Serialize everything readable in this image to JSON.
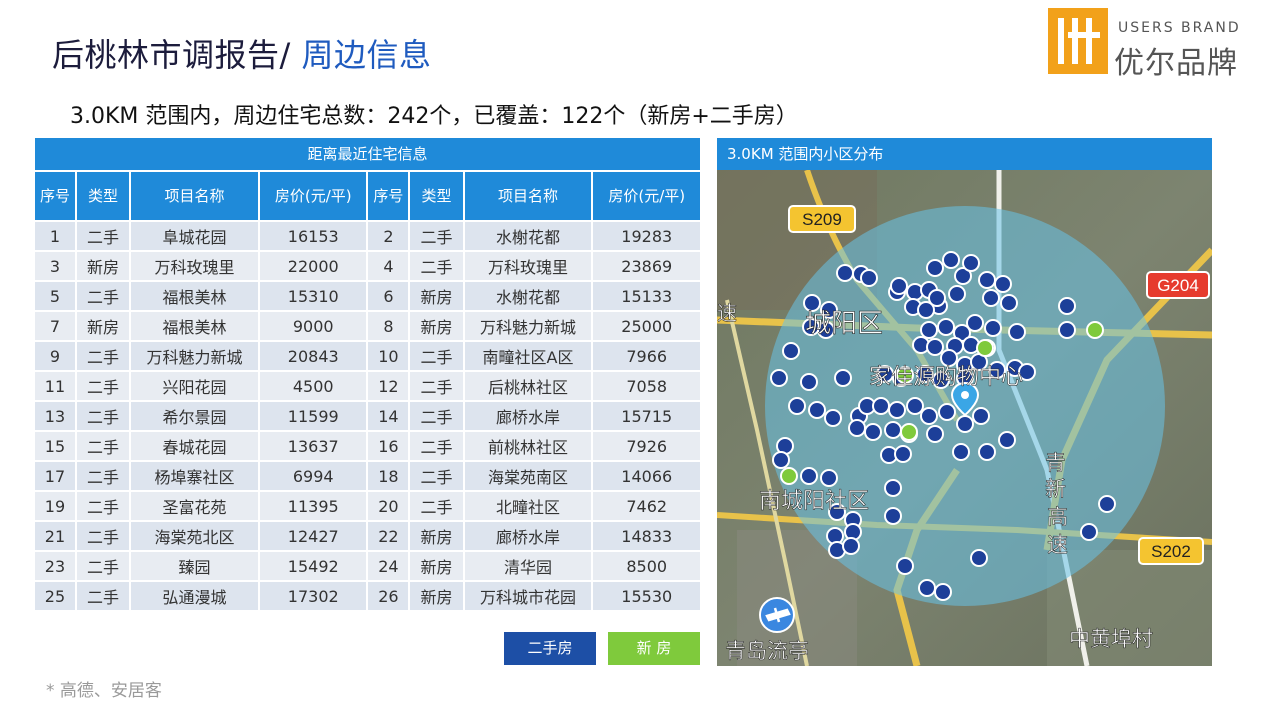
{
  "header": {
    "title_main": "后桃林市调报告/",
    "title_accent": "周边信息"
  },
  "brand": {
    "en": "USERS BRAND",
    "cn": "优尔品牌",
    "mark": "优"
  },
  "subtitle": "3.0KM 范围内，周边住宅总数：242个，已覆盖：122个（新房+二手房）",
  "table": {
    "title": "距离最近住宅信息",
    "columns": [
      "序号",
      "类型",
      "项目名称",
      "房价(元/平)",
      "序号",
      "类型",
      "项目名称",
      "房价(元/平)"
    ],
    "rows": [
      [
        [
          "1",
          "二手",
          "阜城花园",
          "16153"
        ],
        [
          "2",
          "二手",
          "水榭花都",
          "19283"
        ]
      ],
      [
        [
          "3",
          "新房",
          "万科玫瑰里",
          "22000"
        ],
        [
          "4",
          "二手",
          "万科玫瑰里",
          "23869"
        ]
      ],
      [
        [
          "5",
          "二手",
          "福根美林",
          "15310"
        ],
        [
          "6",
          "新房",
          "水榭花都",
          "15133"
        ]
      ],
      [
        [
          "7",
          "新房",
          "福根美林",
          "9000"
        ],
        [
          "8",
          "新房",
          "万科魅力新城",
          "25000"
        ]
      ],
      [
        [
          "9",
          "二手",
          "万科魅力新城",
          "20843"
        ],
        [
          "10",
          "二手",
          "南疃社区A区",
          "7966"
        ]
      ],
      [
        [
          "11",
          "二手",
          "兴阳花园",
          "4500"
        ],
        [
          "12",
          "二手",
          "后桃林社区",
          "7058"
        ]
      ],
      [
        [
          "13",
          "二手",
          "希尔景园",
          "11599"
        ],
        [
          "14",
          "二手",
          "廊桥水岸",
          "15715"
        ]
      ],
      [
        [
          "15",
          "二手",
          "春城花园",
          "13637"
        ],
        [
          "16",
          "二手",
          "前桃林社区",
          "7926"
        ]
      ],
      [
        [
          "17",
          "二手",
          "杨埠寨社区",
          "6994"
        ],
        [
          "18",
          "二手",
          "海棠苑南区",
          "14066"
        ]
      ],
      [
        [
          "19",
          "二手",
          "圣富花苑",
          "11395"
        ],
        [
          "20",
          "二手",
          "北疃社区",
          "7462"
        ]
      ],
      [
        [
          "21",
          "二手",
          "海棠苑北区",
          "12427"
        ],
        [
          "22",
          "新房",
          "廊桥水岸",
          "14833"
        ]
      ],
      [
        [
          "23",
          "二手",
          "臻园",
          "15492"
        ],
        [
          "24",
          "新房",
          "清华园",
          "8500"
        ]
      ],
      [
        [
          "25",
          "二手",
          "弘通漫城",
          "17302"
        ],
        [
          "26",
          "新房",
          "万科城市花园",
          "15530"
        ]
      ]
    ]
  },
  "legend": {
    "second_hand": "二手房",
    "new_house": "新 房"
  },
  "source": "* 高德、安居客",
  "map": {
    "title": "3.0KM 范围内小区分布",
    "labels": {
      "district": "城阳区",
      "mall": "家佳源购物中心",
      "community": "南城阳社区",
      "airport": "青岛流亭",
      "village": "中黄埠村",
      "road_vertical": "青新高速",
      "road_edge": "速"
    },
    "road_badges": {
      "s209": "S209",
      "g204": "G204",
      "s202": "S202"
    },
    "colors": {
      "second_hand": "#1d3f99",
      "new_house": "#7fca3c",
      "accent": "#1f8ad9"
    }
  }
}
